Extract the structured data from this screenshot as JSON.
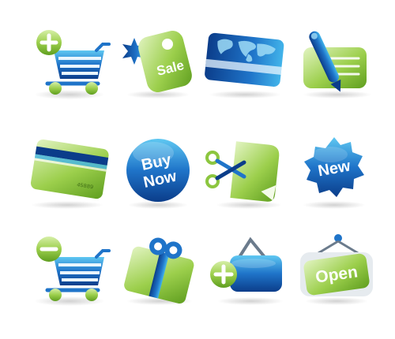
{
  "icons": {
    "sale_tag": {
      "label": "Sale"
    },
    "buy_now": {
      "line1": "Buy",
      "line2": "Now"
    },
    "new_badge": {
      "label": "New"
    },
    "open_sign": {
      "label": "Open"
    },
    "credit_card": {
      "number": "45889"
    }
  },
  "colors": {
    "blue_dark": "#0b3d8a",
    "blue_mid": "#1f74c9",
    "blue_light": "#42b4ea",
    "green_dark": "#5f9e1f",
    "green_mid": "#8cc63f",
    "green_light": "#c9e8a0"
  }
}
